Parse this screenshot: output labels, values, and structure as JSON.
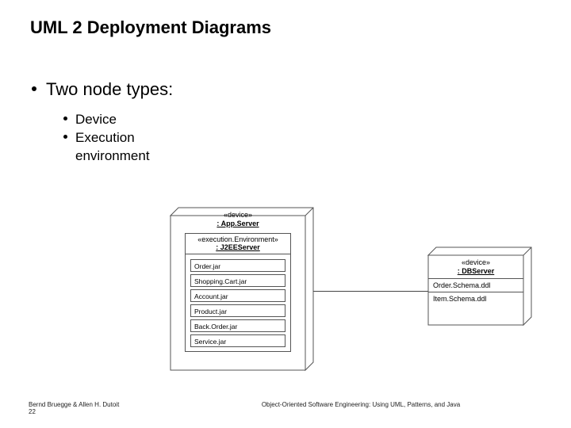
{
  "title": "UML 2 Deployment Diagrams",
  "bullets": {
    "b1": "Two node types:",
    "b2a": "Device",
    "b2b": "Execution",
    "b2b_cont": "environment"
  },
  "appServer": {
    "stereotype": "«device»",
    "name": ": App.Server",
    "execEnv": {
      "stereotype": "«execution.Environment»",
      "name": ": J2EEServer",
      "artifacts": [
        "Order.jar",
        "Shopping.Cart.jar",
        "Account.jar",
        "Product.jar",
        "Back.Order.jar",
        "Service.jar"
      ]
    }
  },
  "dbServer": {
    "stereotype": "«device»",
    "name": ": DBServer",
    "items": [
      "Order.Schema.ddl",
      "Item.Schema.ddl"
    ]
  },
  "footer": {
    "authors": "Bernd Bruegge & Allen H. Dutoit",
    "book": "Object-Oriented Software Engineering: Using UML, Patterns, and Java",
    "page": "22"
  }
}
